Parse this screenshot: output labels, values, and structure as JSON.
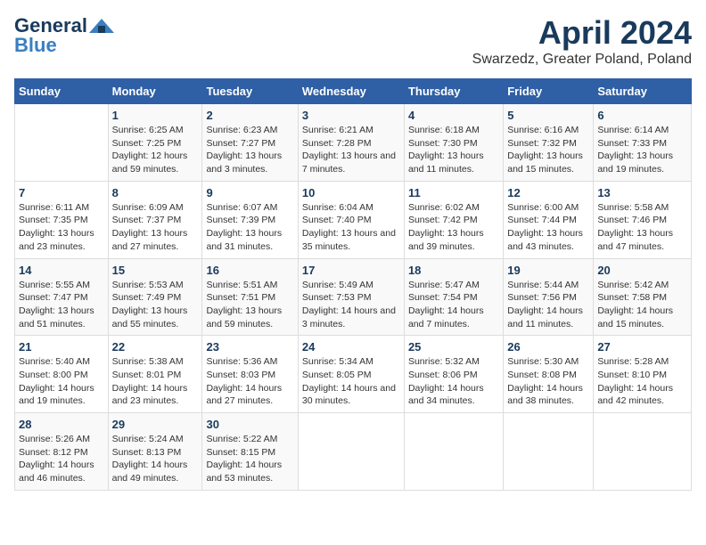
{
  "header": {
    "logo_line1": "General",
    "logo_line2": "Blue",
    "month": "April 2024",
    "location": "Swarzedz, Greater Poland, Poland"
  },
  "days_of_week": [
    "Sunday",
    "Monday",
    "Tuesday",
    "Wednesday",
    "Thursday",
    "Friday",
    "Saturday"
  ],
  "weeks": [
    [
      {
        "num": "",
        "sunrise": "",
        "sunset": "",
        "daylight": ""
      },
      {
        "num": "1",
        "sunrise": "Sunrise: 6:25 AM",
        "sunset": "Sunset: 7:25 PM",
        "daylight": "Daylight: 12 hours and 59 minutes."
      },
      {
        "num": "2",
        "sunrise": "Sunrise: 6:23 AM",
        "sunset": "Sunset: 7:27 PM",
        "daylight": "Daylight: 13 hours and 3 minutes."
      },
      {
        "num": "3",
        "sunrise": "Sunrise: 6:21 AM",
        "sunset": "Sunset: 7:28 PM",
        "daylight": "Daylight: 13 hours and 7 minutes."
      },
      {
        "num": "4",
        "sunrise": "Sunrise: 6:18 AM",
        "sunset": "Sunset: 7:30 PM",
        "daylight": "Daylight: 13 hours and 11 minutes."
      },
      {
        "num": "5",
        "sunrise": "Sunrise: 6:16 AM",
        "sunset": "Sunset: 7:32 PM",
        "daylight": "Daylight: 13 hours and 15 minutes."
      },
      {
        "num": "6",
        "sunrise": "Sunrise: 6:14 AM",
        "sunset": "Sunset: 7:33 PM",
        "daylight": "Daylight: 13 hours and 19 minutes."
      }
    ],
    [
      {
        "num": "7",
        "sunrise": "Sunrise: 6:11 AM",
        "sunset": "Sunset: 7:35 PM",
        "daylight": "Daylight: 13 hours and 23 minutes."
      },
      {
        "num": "8",
        "sunrise": "Sunrise: 6:09 AM",
        "sunset": "Sunset: 7:37 PM",
        "daylight": "Daylight: 13 hours and 27 minutes."
      },
      {
        "num": "9",
        "sunrise": "Sunrise: 6:07 AM",
        "sunset": "Sunset: 7:39 PM",
        "daylight": "Daylight: 13 hours and 31 minutes."
      },
      {
        "num": "10",
        "sunrise": "Sunrise: 6:04 AM",
        "sunset": "Sunset: 7:40 PM",
        "daylight": "Daylight: 13 hours and 35 minutes."
      },
      {
        "num": "11",
        "sunrise": "Sunrise: 6:02 AM",
        "sunset": "Sunset: 7:42 PM",
        "daylight": "Daylight: 13 hours and 39 minutes."
      },
      {
        "num": "12",
        "sunrise": "Sunrise: 6:00 AM",
        "sunset": "Sunset: 7:44 PM",
        "daylight": "Daylight: 13 hours and 43 minutes."
      },
      {
        "num": "13",
        "sunrise": "Sunrise: 5:58 AM",
        "sunset": "Sunset: 7:46 PM",
        "daylight": "Daylight: 13 hours and 47 minutes."
      }
    ],
    [
      {
        "num": "14",
        "sunrise": "Sunrise: 5:55 AM",
        "sunset": "Sunset: 7:47 PM",
        "daylight": "Daylight: 13 hours and 51 minutes."
      },
      {
        "num": "15",
        "sunrise": "Sunrise: 5:53 AM",
        "sunset": "Sunset: 7:49 PM",
        "daylight": "Daylight: 13 hours and 55 minutes."
      },
      {
        "num": "16",
        "sunrise": "Sunrise: 5:51 AM",
        "sunset": "Sunset: 7:51 PM",
        "daylight": "Daylight: 13 hours and 59 minutes."
      },
      {
        "num": "17",
        "sunrise": "Sunrise: 5:49 AM",
        "sunset": "Sunset: 7:53 PM",
        "daylight": "Daylight: 14 hours and 3 minutes."
      },
      {
        "num": "18",
        "sunrise": "Sunrise: 5:47 AM",
        "sunset": "Sunset: 7:54 PM",
        "daylight": "Daylight: 14 hours and 7 minutes."
      },
      {
        "num": "19",
        "sunrise": "Sunrise: 5:44 AM",
        "sunset": "Sunset: 7:56 PM",
        "daylight": "Daylight: 14 hours and 11 minutes."
      },
      {
        "num": "20",
        "sunrise": "Sunrise: 5:42 AM",
        "sunset": "Sunset: 7:58 PM",
        "daylight": "Daylight: 14 hours and 15 minutes."
      }
    ],
    [
      {
        "num": "21",
        "sunrise": "Sunrise: 5:40 AM",
        "sunset": "Sunset: 8:00 PM",
        "daylight": "Daylight: 14 hours and 19 minutes."
      },
      {
        "num": "22",
        "sunrise": "Sunrise: 5:38 AM",
        "sunset": "Sunset: 8:01 PM",
        "daylight": "Daylight: 14 hours and 23 minutes."
      },
      {
        "num": "23",
        "sunrise": "Sunrise: 5:36 AM",
        "sunset": "Sunset: 8:03 PM",
        "daylight": "Daylight: 14 hours and 27 minutes."
      },
      {
        "num": "24",
        "sunrise": "Sunrise: 5:34 AM",
        "sunset": "Sunset: 8:05 PM",
        "daylight": "Daylight: 14 hours and 30 minutes."
      },
      {
        "num": "25",
        "sunrise": "Sunrise: 5:32 AM",
        "sunset": "Sunset: 8:06 PM",
        "daylight": "Daylight: 14 hours and 34 minutes."
      },
      {
        "num": "26",
        "sunrise": "Sunrise: 5:30 AM",
        "sunset": "Sunset: 8:08 PM",
        "daylight": "Daylight: 14 hours and 38 minutes."
      },
      {
        "num": "27",
        "sunrise": "Sunrise: 5:28 AM",
        "sunset": "Sunset: 8:10 PM",
        "daylight": "Daylight: 14 hours and 42 minutes."
      }
    ],
    [
      {
        "num": "28",
        "sunrise": "Sunrise: 5:26 AM",
        "sunset": "Sunset: 8:12 PM",
        "daylight": "Daylight: 14 hours and 46 minutes."
      },
      {
        "num": "29",
        "sunrise": "Sunrise: 5:24 AM",
        "sunset": "Sunset: 8:13 PM",
        "daylight": "Daylight: 14 hours and 49 minutes."
      },
      {
        "num": "30",
        "sunrise": "Sunrise: 5:22 AM",
        "sunset": "Sunset: 8:15 PM",
        "daylight": "Daylight: 14 hours and 53 minutes."
      },
      {
        "num": "",
        "sunrise": "",
        "sunset": "",
        "daylight": ""
      },
      {
        "num": "",
        "sunrise": "",
        "sunset": "",
        "daylight": ""
      },
      {
        "num": "",
        "sunrise": "",
        "sunset": "",
        "daylight": ""
      },
      {
        "num": "",
        "sunrise": "",
        "sunset": "",
        "daylight": ""
      }
    ]
  ]
}
